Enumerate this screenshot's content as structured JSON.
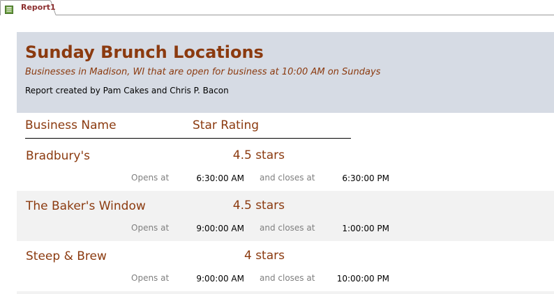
{
  "tab": {
    "label": "Report1",
    "icon": "report-icon"
  },
  "colors": {
    "title": "#8b3a0f",
    "header_band": "#d6dbe4",
    "alt_row": "#f2f2f2",
    "tab_label": "#8c2f2f"
  },
  "report": {
    "title": "Sunday Brunch Locations",
    "subtitle": "Businesses in Madison, WI that are open for business at 10:00 AM on Sundays",
    "credit": "Report created by Pam Cakes and Chris P. Bacon"
  },
  "columns": {
    "business_name": "Business Name",
    "star_rating": "Star Rating"
  },
  "records": [
    {
      "name": "Bradbury's",
      "rating": "4.5 stars",
      "opens_label": "Opens at",
      "open_time": "6:30:00 AM",
      "closes_label": "and closes at",
      "close_time": "6:30:00 PM"
    },
    {
      "name": "The Baker's Window",
      "rating": "4.5 stars",
      "opens_label": "Opens at",
      "open_time": "9:00:00 AM",
      "closes_label": "and closes at",
      "close_time": "1:00:00 PM"
    },
    {
      "name": "Steep & Brew",
      "rating": "4 stars",
      "opens_label": "Opens at",
      "open_time": "9:00:00 AM",
      "closes_label": "and closes at",
      "close_time": "10:00:00 PM"
    }
  ]
}
